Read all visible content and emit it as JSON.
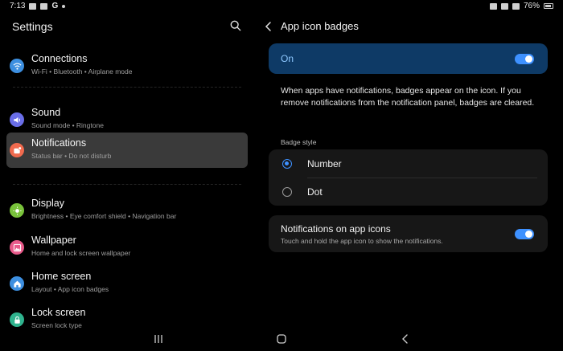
{
  "status_bar": {
    "time": "7:13",
    "battery": "76%"
  },
  "left_panel": {
    "title": "Settings",
    "items": [
      {
        "title": "Connections",
        "subtitle": "Wi-Fi • Bluetooth • Airplane mode",
        "icon": "wifi-icon",
        "color": "#3d8fe0"
      },
      {
        "title": "Sound",
        "subtitle": "Sound mode • Ringtone",
        "icon": "speaker-icon",
        "color": "#6a6ee8"
      },
      {
        "title": "Notifications",
        "subtitle": "Status bar • Do not disturb",
        "icon": "notification-icon",
        "color": "#f06a4e"
      },
      {
        "title": "Display",
        "subtitle": "Brightness • Eye comfort shield • Navigation bar",
        "icon": "sun-icon",
        "color": "#79c23b"
      },
      {
        "title": "Wallpaper",
        "subtitle": "Home and lock screen wallpaper",
        "icon": "image-icon",
        "color": "#e85a8a"
      },
      {
        "title": "Home screen",
        "subtitle": "Layout • App icon badges",
        "icon": "home-icon",
        "color": "#3d8fe0"
      },
      {
        "title": "Lock screen",
        "subtitle": "Screen lock type",
        "icon": "lock-icon",
        "color": "#2fb38e"
      }
    ]
  },
  "right_panel": {
    "title": "App icon badges",
    "master_toggle": {
      "label": "On",
      "enabled": true
    },
    "description": "When apps have notifications, badges appear on the icon. If you remove notifications from the notification panel, badges are cleared.",
    "badge_style": {
      "label": "Badge style",
      "options": [
        "Number",
        "Dot"
      ],
      "selected": "Number"
    },
    "notifications_on_icons": {
      "title": "Notifications on app icons",
      "subtitle": "Touch and hold the app icon to show the notifications.",
      "enabled": true
    }
  },
  "colors": {
    "accent": "#3e91ff",
    "active_card": "#0e3a66"
  }
}
